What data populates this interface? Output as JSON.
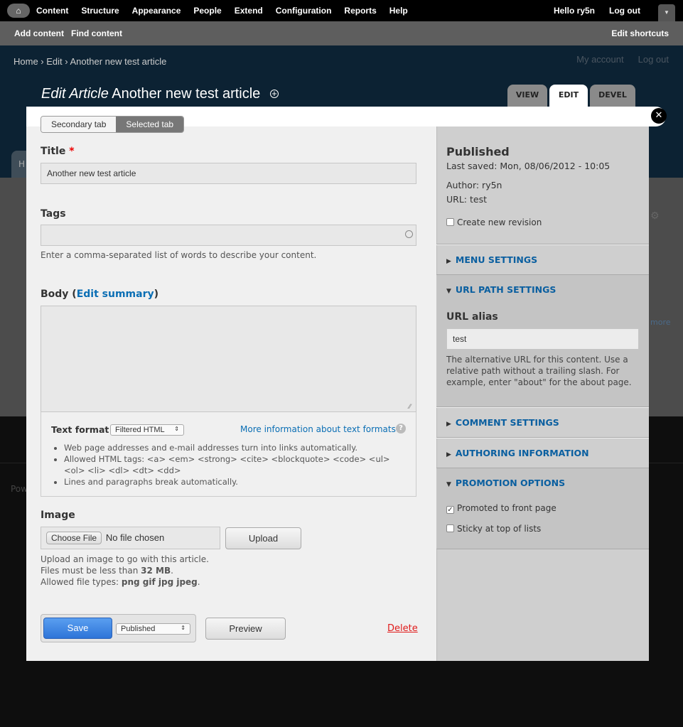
{
  "toolbar": {
    "menu": [
      "Content",
      "Structure",
      "Appearance",
      "People",
      "Extend",
      "Configuration",
      "Reports",
      "Help"
    ],
    "hello": "Hello",
    "user": "ry5n",
    "logout": "Log out"
  },
  "shortcuts": {
    "add": "Add content",
    "find": "Find content",
    "edit": "Edit shortcuts"
  },
  "breadcrumb": [
    "Home",
    "Edit",
    "Another new test article"
  ],
  "secondary_menu": [
    "My account",
    "Log out"
  ],
  "page": {
    "type": "Edit Article",
    "title": "Another new test article"
  },
  "primary_tabs": [
    "VIEW",
    "EDIT",
    "DEVEL"
  ],
  "background": {
    "frag_h": "H",
    "more": "more",
    "powered": "Pow"
  },
  "modal": {
    "tabs": {
      "secondary": "Secondary tab",
      "selected": "Selected tab"
    },
    "title_label": "Title",
    "required": "*",
    "title_value": "Another new test article",
    "tags_label": "Tags",
    "tags_value": "",
    "tags_desc": "Enter a comma-separated list of words to describe your content.",
    "body_label": "Body",
    "edit_summary": "Edit summary",
    "body_value": "",
    "text_format_label": "Text format",
    "text_format_value": "Filtered HTML",
    "more_info": "More information about text formats",
    "format_tips": [
      "Web page addresses and e-mail addresses turn into links automatically.",
      "Allowed HTML tags: <a> <em> <strong> <cite> <blockquote> <code> <ul> <ol> <li> <dl> <dt> <dd>",
      "Lines and paragraphs break automatically."
    ],
    "image_label": "Image",
    "choose_file": "Choose File",
    "no_file": "No file chosen",
    "upload": "Upload",
    "image_desc1": "Upload an image to go with this article.",
    "image_desc2a": "Files must be less than ",
    "image_desc2b": "32 MB",
    "image_desc2c": ".",
    "image_desc3a": "Allowed file types: ",
    "image_desc3b": "png gif jpg jpeg",
    "image_desc3c": ".",
    "save": "Save",
    "status_value": "Published",
    "preview": "Preview",
    "delete": "Delete"
  },
  "sidebar": {
    "status": "Published",
    "last_saved": "Last saved: Mon, 08/06/2012 - 10:05",
    "author": "Author: ry5n",
    "url": "URL: test",
    "new_revision": "Create new revision",
    "new_revision_checked": false,
    "sections": [
      "MENU SETTINGS",
      "URL PATH SETTINGS",
      "COMMENT SETTINGS",
      "AUTHORING INFORMATION",
      "PROMOTION OPTIONS"
    ],
    "url_alias_label": "URL alias",
    "url_alias_value": "test",
    "url_alias_desc": "The alternative URL for this content. Use a relative path without a trailing slash. For example, enter \"about\" for the about page.",
    "promoted": "Promoted to front page",
    "promoted_checked": true,
    "sticky": "Sticky at top of lists",
    "sticky_checked": false
  }
}
